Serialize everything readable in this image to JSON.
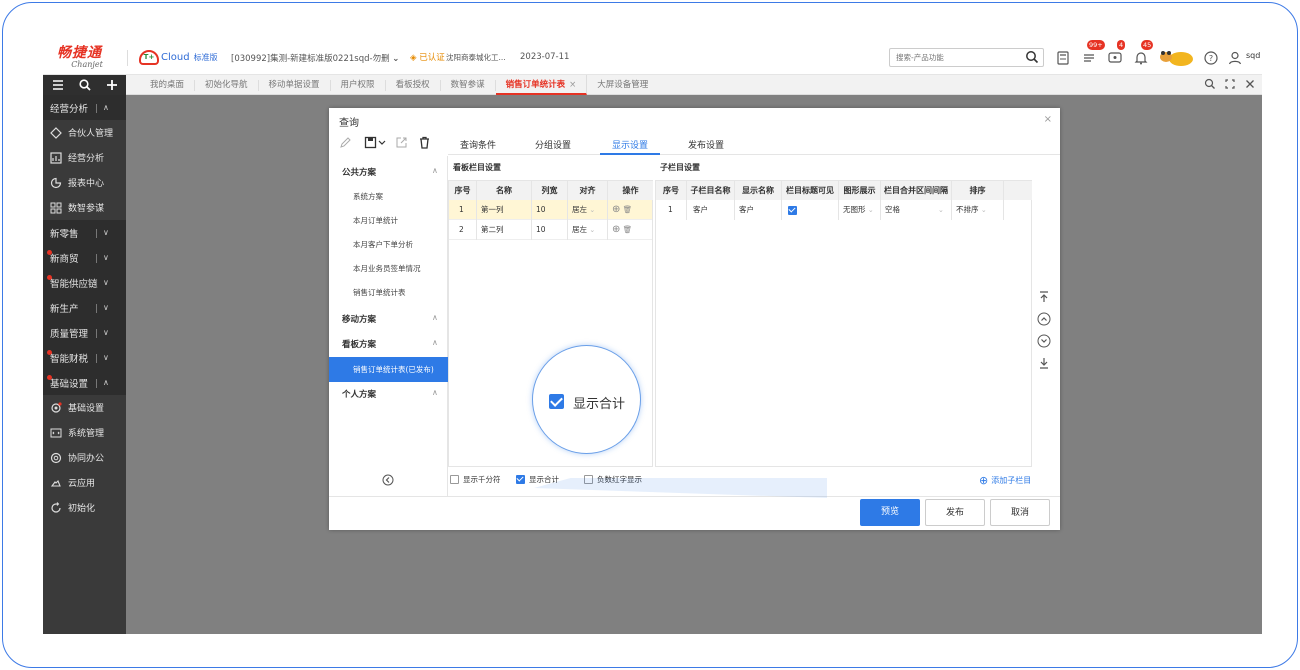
{
  "header": {
    "logo_cn": "畅捷通",
    "logo_en": "Chanjet",
    "cloud_name": "Cloud",
    "cloud_edition": "标准版",
    "company": "[030992]集测-新建标准版0221sqd-勿删",
    "certified": "已认证",
    "city_company": "沈阳商泰城化工...",
    "date": "2023-07-11",
    "search_placeholder": "搜索-产品功能",
    "badge_messages": "99+",
    "badge_tasks": "4",
    "badge_alerts": "45",
    "user": "sqd"
  },
  "tabs": [
    {
      "label": "我的桌面"
    },
    {
      "label": "初始化导航"
    },
    {
      "label": "移动单据设置"
    },
    {
      "label": "用户权限"
    },
    {
      "label": "看板授权"
    },
    {
      "label": "数智参谋"
    },
    {
      "label": "销售订单统计表",
      "active": true
    },
    {
      "label": "大屏设备管理"
    }
  ],
  "sidebar": {
    "items": [
      {
        "label": "经营分析",
        "type": "group",
        "state": "∧"
      },
      {
        "label": "合伙人管理",
        "type": "sub"
      },
      {
        "label": "经营分析",
        "type": "sub"
      },
      {
        "label": "报表中心",
        "type": "sub"
      },
      {
        "label": "数智参谋",
        "type": "sub"
      },
      {
        "label": "新零售",
        "type": "group",
        "state": "∨"
      },
      {
        "label": "新商贸",
        "type": "group",
        "state": "∨"
      },
      {
        "label": "智能供应链",
        "type": "group",
        "state": "∨"
      },
      {
        "label": "新生产",
        "type": "group",
        "state": "∨"
      },
      {
        "label": "质量管理",
        "type": "group",
        "state": "∨"
      },
      {
        "label": "智能财税",
        "type": "group",
        "state": "∨"
      },
      {
        "label": "基础设置",
        "type": "group",
        "state": "∧"
      },
      {
        "label": "基础设置",
        "type": "sub"
      },
      {
        "label": "系统管理",
        "type": "sub"
      },
      {
        "label": "协同办公",
        "type": "sub"
      },
      {
        "label": "云应用",
        "type": "sub"
      },
      {
        "label": "初始化",
        "type": "sub"
      }
    ]
  },
  "dialog": {
    "title": "查询",
    "close": "×",
    "tabs": [
      "查询条件",
      "分组设置",
      "显示设置",
      "发布设置"
    ],
    "active_tab": "显示设置",
    "schemes": {
      "public_label": "公共方案",
      "public_items": [
        "系统方案",
        "本月订单统计",
        "本月客户下单分析",
        "本月业务员签单情况",
        "销售订单统计表"
      ],
      "mobile_label": "移动方案",
      "board_label": "看板方案",
      "board_selected": "销售订单统计表(已发布)",
      "personal_label": "个人方案",
      "collapse_mark": "∧"
    },
    "board_columns": {
      "title": "看板栏目设置",
      "headers": [
        "序号",
        "名称",
        "列宽",
        "对齐",
        "操作"
      ],
      "rows": [
        {
          "no": "1",
          "name": "第一列",
          "width": "10",
          "align": "居左"
        },
        {
          "no": "2",
          "name": "第二列",
          "width": "10",
          "align": "居左"
        }
      ]
    },
    "sub_columns": {
      "title": "子栏目设置",
      "headers": [
        "序号",
        "子栏目名称",
        "显示名称",
        "栏目标题可见",
        "图形展示",
        "栏目合并区间间隔",
        "排序"
      ],
      "rows": [
        {
          "no": "1",
          "name": "客户",
          "display": "客户",
          "title_visible": true,
          "graph": "无图形",
          "merge": "空格",
          "sort": "不排序"
        }
      ]
    },
    "options": [
      {
        "label": "显示千分符",
        "checked": false
      },
      {
        "label": "显示合计",
        "checked": true
      },
      {
        "label": "负数红字显示",
        "checked": false
      }
    ],
    "add_sub_column": "添加子栏目",
    "buttons": {
      "preview": "预览",
      "publish": "发布",
      "cancel": "取消"
    },
    "callout_label": "显示合计"
  },
  "colors": {
    "brand_red": "#e63324",
    "accent_blue": "#2e7ae6",
    "sidebar_bg": "#3a3a3a",
    "content_gray": "#808080"
  }
}
